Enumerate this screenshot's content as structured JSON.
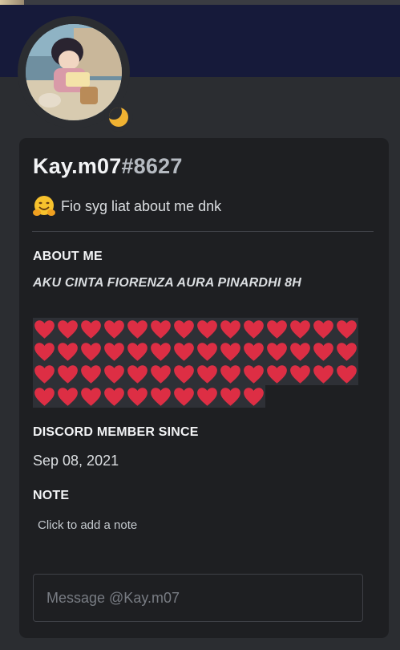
{
  "user": {
    "username": "Kay.m07",
    "discriminator": "#8627",
    "status_emoji": "hugging-face-emoji",
    "custom_status": "Fio syg liat about me dnk",
    "presence": "idle"
  },
  "sections": {
    "about_me_title": "ABOUT ME",
    "about_me_text": "AKU CINTA FIORENZA AURA PINARDHI 8H",
    "about_me_heart_count": 52,
    "member_since_title": "DISCORD MEMBER SINCE",
    "member_since_date": "Sep 08, 2021",
    "note_title": "NOTE",
    "note_placeholder": "Click to add a note"
  },
  "message": {
    "placeholder": "Message @Kay.m07"
  },
  "colors": {
    "banner": "#161a3a",
    "background": "#2b2d31",
    "card": "#1e1f22",
    "idle": "#f0b232",
    "heart": "#dd2e44"
  },
  "icons": {
    "heart": "red-heart-emoji",
    "presence": "moon-icon"
  }
}
